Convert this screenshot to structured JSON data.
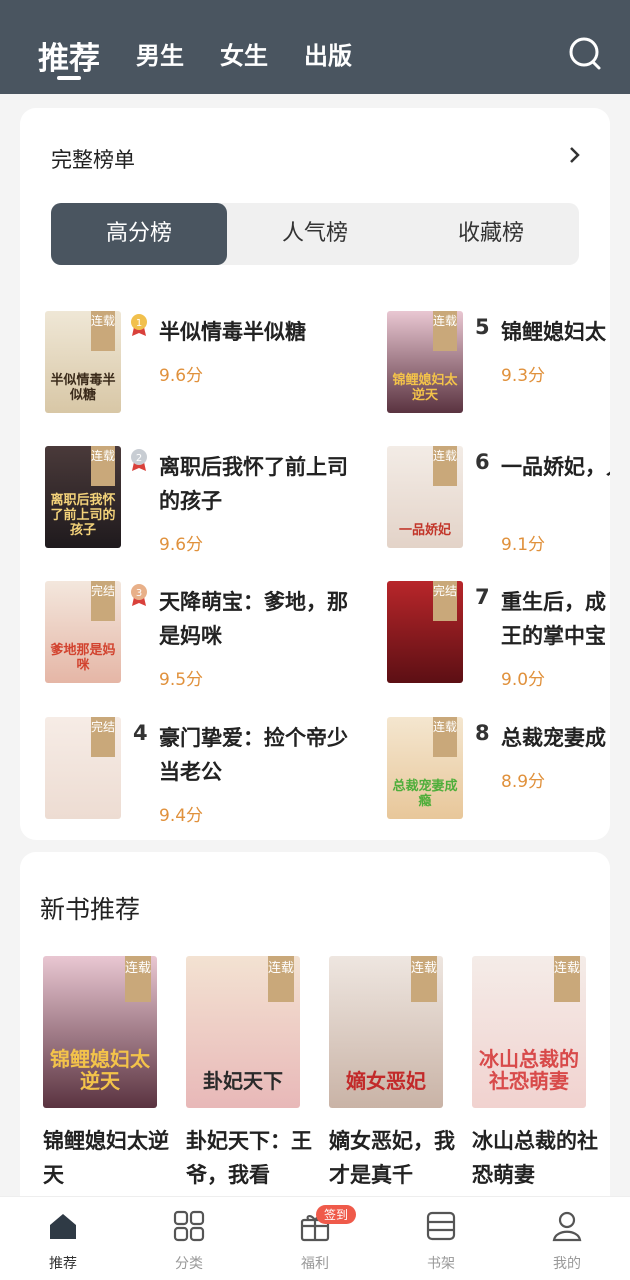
{
  "topbar": {
    "tabs": [
      "推荐",
      "男生",
      "女生",
      "出版"
    ]
  },
  "ranking": {
    "title": "完整榜单",
    "segments": [
      "高分榜",
      "人气榜",
      "收藏榜"
    ],
    "left_items": [
      {
        "title": "半似情毒半似糖",
        "score": "9.6分",
        "tag": "连载",
        "cover_text": "半似情毒半似糖",
        "medal": "gold"
      },
      {
        "title": "离职后我怀了前上司的孩子",
        "score": "9.6分",
        "tag": "连载",
        "cover_text": "离职后我怀了前上司的孩子",
        "medal": "silver"
      },
      {
        "title": "天降萌宝：爹地，那是妈咪",
        "score": "9.5分",
        "tag": "完结",
        "cover_text": "爹地那是妈咪",
        "medal": "bronze"
      },
      {
        "rank": "4",
        "title": "豪门挚爱：捡个帝少当老公",
        "score": "9.4分",
        "tag": "完结",
        "cover_text": ""
      }
    ],
    "right_items": [
      {
        "rank": "5",
        "title": "锦鲤媳妇太",
        "score": "9.3分",
        "tag": "连载",
        "cover_text": "锦鲤媳妇太逆天"
      },
      {
        "rank": "6",
        "title": "一品娇妃，人宠妻忙",
        "score": "9.1分",
        "tag": "连载",
        "cover_text": "一品娇妃"
      },
      {
        "rank": "7",
        "title": "重生后，成王的掌中宝",
        "score": "9.0分",
        "tag": "完结",
        "cover_text": ""
      },
      {
        "rank": "8",
        "title": "总裁宠妻成",
        "score": "8.9分",
        "tag": "连载",
        "cover_text": "总裁宠妻成瘾"
      }
    ]
  },
  "new_books": {
    "title": "新书推荐",
    "items": [
      {
        "title": "锦鲤媳妇太逆天",
        "tag": "连载",
        "cover_text": "锦鲤媳妇太逆天"
      },
      {
        "title": "卦妃天下：王爷，我看",
        "tag": "连载",
        "cover_text": "卦妃天下"
      },
      {
        "title": "嫡女恶妃，我才是真千",
        "tag": "连载",
        "cover_text": "嫡女恶妃"
      },
      {
        "title": "冰山总裁的社恐萌妻",
        "tag": "连载",
        "cover_text": "冰山总裁的社恐萌妻"
      }
    ]
  },
  "bottom_nav": {
    "items": [
      "推荐",
      "分类",
      "福利",
      "书架",
      "我的"
    ],
    "badge": "签到"
  },
  "colors": {
    "topbar": "#4a5560",
    "score": "#e0913c",
    "badge": "#ef5a4a",
    "tag": "#c9a87a"
  }
}
